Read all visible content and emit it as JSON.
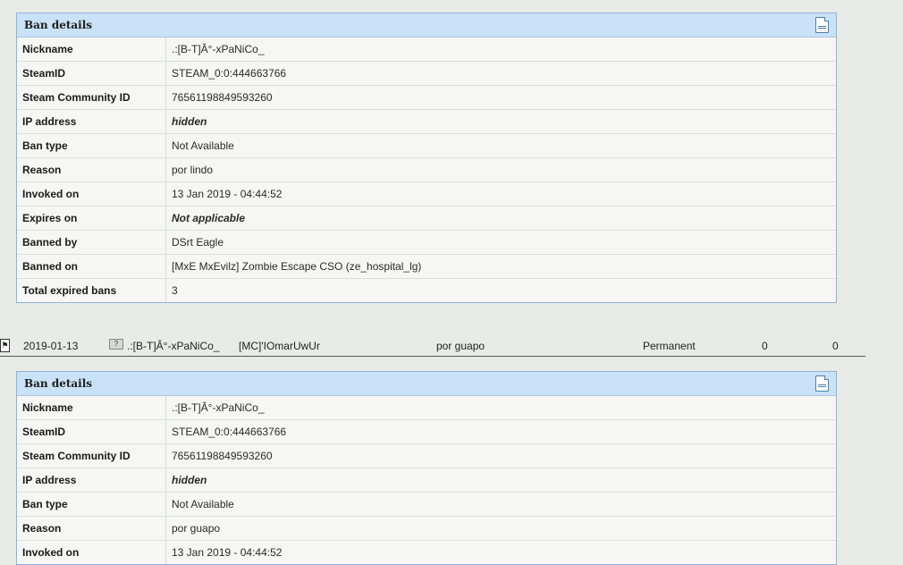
{
  "panel1": {
    "title": "Ban details",
    "rows": [
      {
        "label": "Nickname",
        "value": ".:[B-T]Â°-xPaNiCo_"
      },
      {
        "label": "SteamID",
        "value": "STEAM_0:0:444663766"
      },
      {
        "label": "Steam Community ID",
        "value": "76561198849593260"
      },
      {
        "label": "IP address",
        "value": "hidden"
      },
      {
        "label": "Ban type",
        "value": "Not Available"
      },
      {
        "label": "Reason",
        "value": "por lindo"
      },
      {
        "label": "Invoked on",
        "value": "13 Jan 2019 - 04:44:52"
      },
      {
        "label": "Expires on",
        "value": "Not applicable"
      },
      {
        "label": "Banned by",
        "value": "DSrt Eagle"
      },
      {
        "label": "Banned on",
        "value": "[MxE MxEvilz] Zombie Escape CSO (ze_hospital_lg)"
      },
      {
        "label": "Total expired bans",
        "value": "3"
      }
    ]
  },
  "ban_row": {
    "date": "2019-01-13",
    "flag": "?",
    "player": ".:[B-T]Â°-xPaNiCo_",
    "admin": "[MC]'IOmarUwUr",
    "reason": "por guapo",
    "length": "Permanent",
    "count1": "0",
    "count2": "0"
  },
  "panel2": {
    "title": "Ban details",
    "rows": [
      {
        "label": "Nickname",
        "value": ".:[B-T]Â°-xPaNiCo_"
      },
      {
        "label": "SteamID",
        "value": "STEAM_0:0:444663766"
      },
      {
        "label": "Steam Community ID",
        "value": "76561198849593260"
      },
      {
        "label": "IP address",
        "value": "hidden"
      },
      {
        "label": "Ban type",
        "value": "Not Available"
      },
      {
        "label": "Reason",
        "value": "por guapo"
      },
      {
        "label": "Invoked on",
        "value": "13 Jan 2019 - 04:44:52"
      }
    ]
  },
  "icons": {
    "details": "document-icon",
    "game": "game-mod-icon",
    "flag": "unknown-country-flag-icon"
  },
  "colors": {
    "panel_header": "#c9e2f7",
    "panel_border": "#8fb3d4",
    "link": "#4a6a88",
    "expired": "#e01010"
  }
}
